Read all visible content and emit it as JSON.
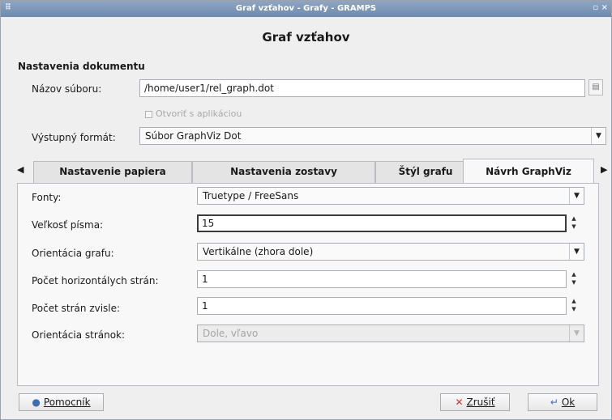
{
  "window": {
    "title": "Graf vzťahov - Grafy - GRAMPS",
    "menu_glyph": "⠿",
    "controls_glyph": "▫ ×"
  },
  "dialog": {
    "heading": "Graf vzťahov"
  },
  "document_settings": {
    "section_title": "Nastavenia dokumentu",
    "filename_label": "Názov súboru:",
    "filename_value": "/home/user1/rel_graph.dot",
    "open_with_app_label": "Otvoriť s aplikáciou",
    "open_with_app_checked": false,
    "output_format_label": "Výstupný formát:",
    "output_format_value": "Súbor GraphViz Dot"
  },
  "tabs": [
    {
      "label": "Nastavenie papiera",
      "active": false
    },
    {
      "label": "Nastavenia zostavy",
      "active": false
    },
    {
      "label": "Štýl grafu",
      "active": false
    },
    {
      "label": "Návrh GraphViz",
      "active": true
    }
  ],
  "graphviz": {
    "fonts_label": "Fonty:",
    "fonts_value": "Truetype / FreeSans",
    "font_size_label": "Veľkosť písma:",
    "font_size_value": "15",
    "graph_orientation_label": "Orientácia grafu:",
    "graph_orientation_value": "Vertikálne (zhora dole)",
    "horizontal_pages_label": "Počet horizontálych strán:",
    "horizontal_pages_value": "1",
    "vertical_pages_label": "Počet strán zvisle:",
    "vertical_pages_value": "1",
    "page_orientation_label": "Orientácia stránok:",
    "page_orientation_value": "Dole, vľavo"
  },
  "buttons": {
    "help_label": "Pomocník",
    "cancel_label": "Zrušiť",
    "ok_label": "Ok"
  },
  "colors": {
    "titlebar": "#7a94b8",
    "cancel_icon": "#d0312d",
    "ok_icon": "#3d6fb5",
    "help_icon": "#3d6fb5"
  }
}
